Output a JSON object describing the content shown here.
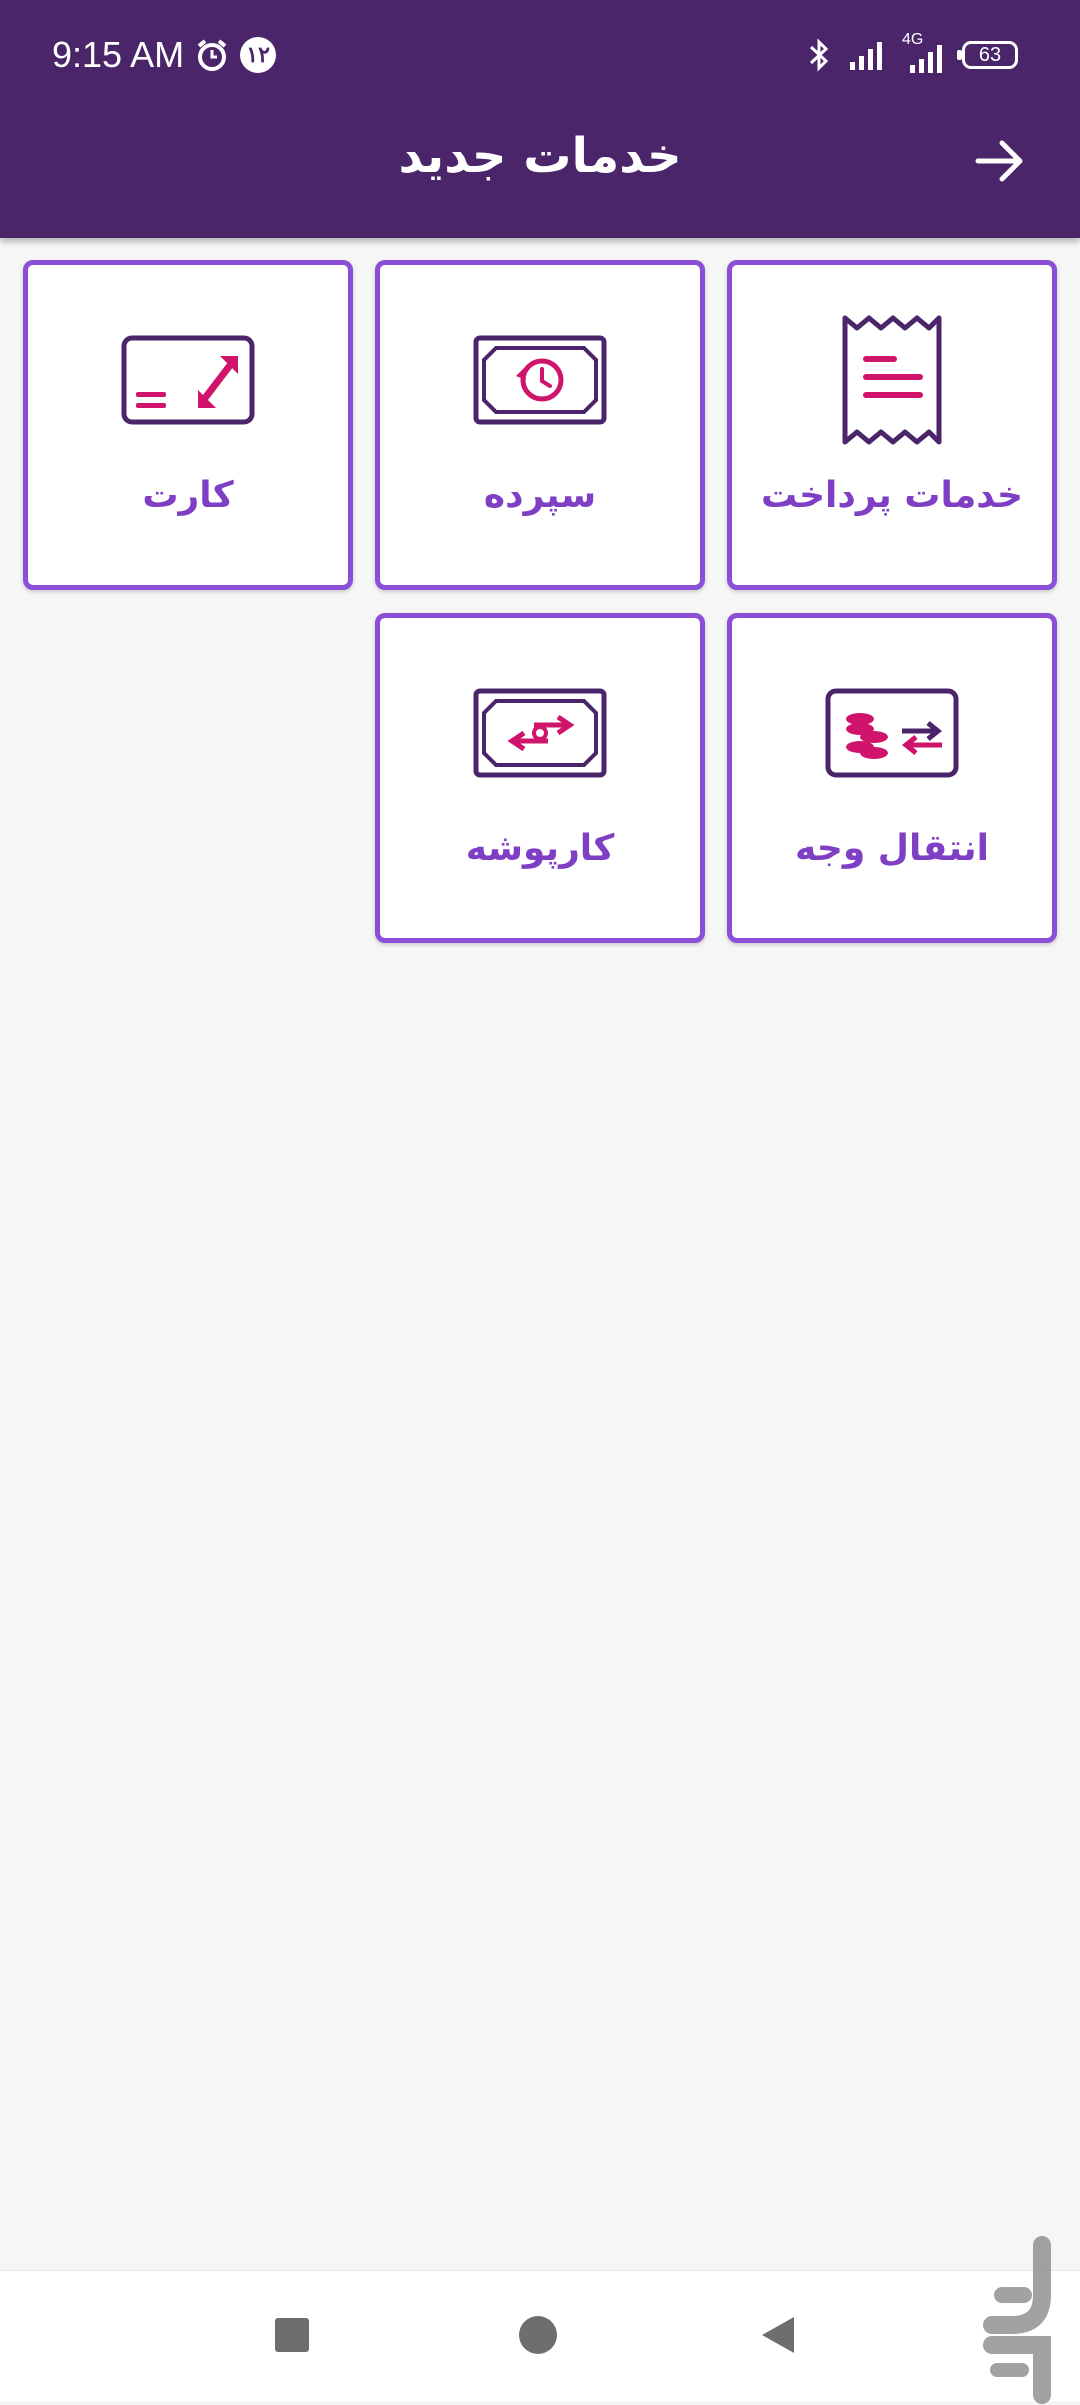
{
  "status_bar": {
    "time": "9:15 AM",
    "badge": "۱۲",
    "network": "4G",
    "battery": "63"
  },
  "header": {
    "title": "خدمات جدید"
  },
  "tiles": [
    {
      "label": "خدمات پرداخت",
      "icon": "receipt-icon"
    },
    {
      "label": "سپرده",
      "icon": "deposit-history-icon"
    },
    {
      "label": "کارت",
      "icon": "card-resize-icon"
    },
    {
      "label": "انتقال وجه",
      "icon": "money-transfer-icon"
    },
    {
      "label": "کارپوشه",
      "icon": "cash-exchange-icon"
    }
  ],
  "colors": {
    "appbar": "#4b2569",
    "tile_border": "#8a4fd6",
    "label": "#7f3fc5",
    "icon_dark": "#4b2569",
    "icon_accent": "#d1146b"
  }
}
